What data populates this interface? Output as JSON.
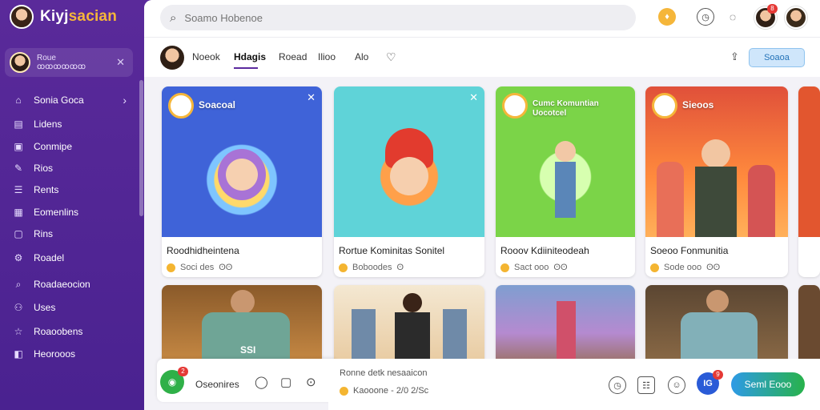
{
  "brand": {
    "name_main": "Kiyj",
    "name_accent": "sacian"
  },
  "profile": {
    "line1": "Roue",
    "line2": "ꝏꝏꝏꝏꝏꝏ",
    "close_icon": "close-icon"
  },
  "sidebar": {
    "items": [
      {
        "label": "Sonia Goca",
        "icon": "home-icon",
        "glyph": "⌂"
      },
      {
        "label": "Lidens",
        "icon": "doc-icon",
        "glyph": "▤"
      },
      {
        "label": "Conmipe",
        "icon": "image-icon",
        "glyph": "▣"
      },
      {
        "label": "Rios",
        "icon": "pen-icon",
        "glyph": "✎"
      },
      {
        "label": "Rents",
        "icon": "list-icon",
        "glyph": "☰"
      },
      {
        "label": "Eomenlins",
        "icon": "grid-icon",
        "glyph": "▦"
      },
      {
        "label": "Rins",
        "icon": "file-icon",
        "glyph": "▢"
      },
      {
        "label": "Roadel",
        "icon": "settings-icon",
        "glyph": "⚙"
      },
      {
        "label": "Roadaeocion",
        "icon": "search-icon",
        "glyph": "⌕"
      },
      {
        "label": "Uses",
        "icon": "people-icon",
        "glyph": "⚇"
      },
      {
        "label": "Roaoobens",
        "icon": "star-icon",
        "glyph": "☆"
      },
      {
        "label": "Heorooos",
        "icon": "bookmark-icon",
        "glyph": "◧"
      }
    ]
  },
  "search": {
    "placeholder": "Soamo Hobenoe"
  },
  "top": {
    "notif_count": "8"
  },
  "tabs": [
    {
      "label": "Noeok"
    },
    {
      "label": "Hdagis"
    },
    {
      "label": "Roead"
    },
    {
      "label": "Ilioo"
    },
    {
      "label": "Alo"
    }
  ],
  "tab_button": "Soaoa",
  "cards": [
    {
      "tag": "Soacoal",
      "title": "Roodhidheintena",
      "meta": "Soci des",
      "meta2": "ʘʘ"
    },
    {
      "tag": "",
      "title": "Rortue Kominitas  Sonitel",
      "meta": "Boboodes",
      "meta2": "ʘ"
    },
    {
      "tag": "Cumc Komuntian\nUocotcel",
      "title": "Rooov Kdiiniteodeah",
      "meta": "Sact ooo",
      "meta2": "ʘʘ"
    },
    {
      "tag": "Sieoos",
      "title": "Soeoo Fonmunitia",
      "meta": "Sode ooo",
      "meta2": "ʘʘ"
    }
  ],
  "bottom_cards": [
    {
      "caption": "SSI"
    },
    {
      "caption": ""
    },
    {
      "caption": ""
    },
    {
      "caption": ""
    }
  ],
  "bottombar": {
    "label": "Oseonires",
    "badge": "2"
  },
  "composer": {
    "title": "Ronne detk nesaaicon",
    "meta": "Kaooone - 2/0  2/Sc",
    "blue_label": "IG",
    "blue_badge": "9",
    "send": "Seml Eooo"
  },
  "colors": {
    "sidebar": "#5a2a9a",
    "accent": "#f5b63a",
    "primary_btn": "#2e9ae6",
    "green": "#2fb048"
  }
}
